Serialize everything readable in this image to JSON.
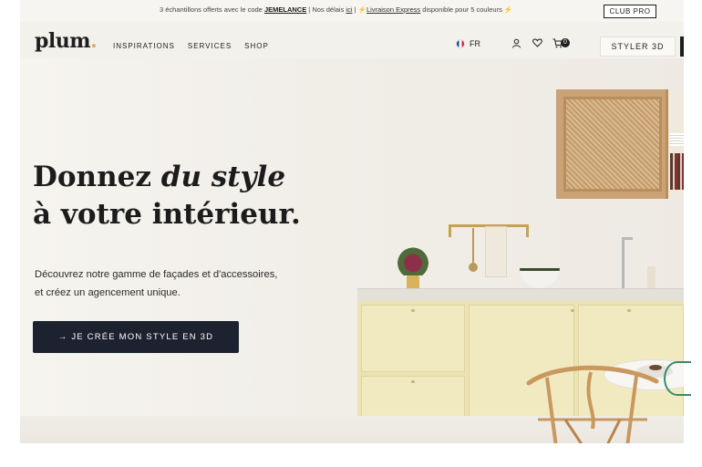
{
  "announcement": {
    "part1": "3 échantillons offerts avec le code ",
    "code": "JEMELANCE",
    "part2": " | Nos délais ",
    "link_ici": "ici",
    "part3": " | ",
    "express_link": "Livraison Express",
    "part4": " disponible pour 5 couleurs ",
    "club_pro": "CLUB PRO"
  },
  "nav": {
    "logo": "plum",
    "links": [
      "INSPIRATIONS",
      "SERVICES",
      "SHOP"
    ],
    "lang": "FR",
    "cart_count": "0",
    "styler": "STYLER 3D"
  },
  "hero": {
    "headline_line1_a": "Donnez ",
    "headline_line1_em": "du style",
    "headline_line2": "à votre intérieur.",
    "sub_line1": "Découvrez notre gamme de façades et d'accessoires,",
    "sub_line2": "et créez un agencement unique.",
    "cta": "→ JE CRÉE MON STYLE EN 3D"
  },
  "colors": {
    "dark": "#1c2230",
    "accent": "#d4b15f",
    "cabinet_yellow": "#ebe3b3",
    "wood": "#c9a275"
  }
}
